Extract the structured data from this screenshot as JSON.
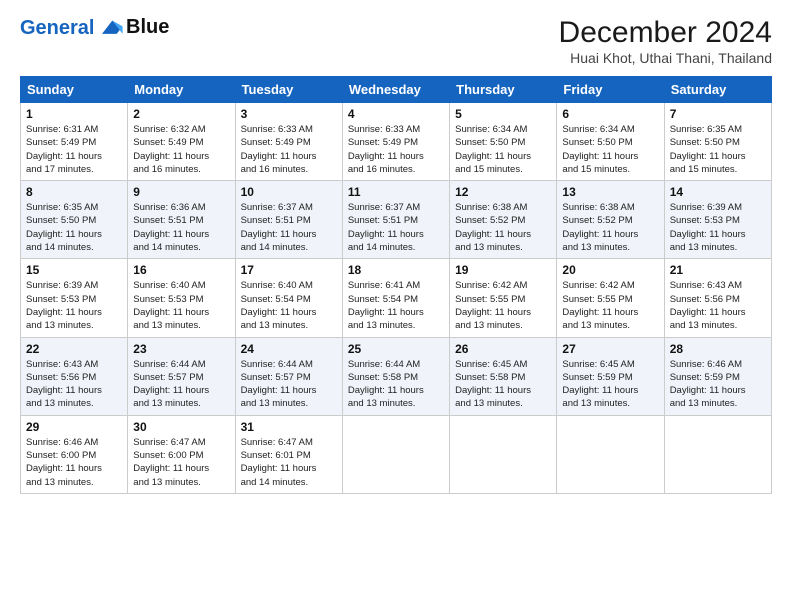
{
  "logo": {
    "line1": "General",
    "line2": "Blue"
  },
  "title": "December 2024",
  "subtitle": "Huai Khot, Uthai Thani, Thailand",
  "weekdays": [
    "Sunday",
    "Monday",
    "Tuesday",
    "Wednesday",
    "Thursday",
    "Friday",
    "Saturday"
  ],
  "weeks": [
    [
      {
        "day": "1",
        "info": "Sunrise: 6:31 AM\nSunset: 5:49 PM\nDaylight: 11 hours\nand 17 minutes."
      },
      {
        "day": "2",
        "info": "Sunrise: 6:32 AM\nSunset: 5:49 PM\nDaylight: 11 hours\nand 16 minutes."
      },
      {
        "day": "3",
        "info": "Sunrise: 6:33 AM\nSunset: 5:49 PM\nDaylight: 11 hours\nand 16 minutes."
      },
      {
        "day": "4",
        "info": "Sunrise: 6:33 AM\nSunset: 5:49 PM\nDaylight: 11 hours\nand 16 minutes."
      },
      {
        "day": "5",
        "info": "Sunrise: 6:34 AM\nSunset: 5:50 PM\nDaylight: 11 hours\nand 15 minutes."
      },
      {
        "day": "6",
        "info": "Sunrise: 6:34 AM\nSunset: 5:50 PM\nDaylight: 11 hours\nand 15 minutes."
      },
      {
        "day": "7",
        "info": "Sunrise: 6:35 AM\nSunset: 5:50 PM\nDaylight: 11 hours\nand 15 minutes."
      }
    ],
    [
      {
        "day": "8",
        "info": "Sunrise: 6:35 AM\nSunset: 5:50 PM\nDaylight: 11 hours\nand 14 minutes."
      },
      {
        "day": "9",
        "info": "Sunrise: 6:36 AM\nSunset: 5:51 PM\nDaylight: 11 hours\nand 14 minutes."
      },
      {
        "day": "10",
        "info": "Sunrise: 6:37 AM\nSunset: 5:51 PM\nDaylight: 11 hours\nand 14 minutes."
      },
      {
        "day": "11",
        "info": "Sunrise: 6:37 AM\nSunset: 5:51 PM\nDaylight: 11 hours\nand 14 minutes."
      },
      {
        "day": "12",
        "info": "Sunrise: 6:38 AM\nSunset: 5:52 PM\nDaylight: 11 hours\nand 13 minutes."
      },
      {
        "day": "13",
        "info": "Sunrise: 6:38 AM\nSunset: 5:52 PM\nDaylight: 11 hours\nand 13 minutes."
      },
      {
        "day": "14",
        "info": "Sunrise: 6:39 AM\nSunset: 5:53 PM\nDaylight: 11 hours\nand 13 minutes."
      }
    ],
    [
      {
        "day": "15",
        "info": "Sunrise: 6:39 AM\nSunset: 5:53 PM\nDaylight: 11 hours\nand 13 minutes."
      },
      {
        "day": "16",
        "info": "Sunrise: 6:40 AM\nSunset: 5:53 PM\nDaylight: 11 hours\nand 13 minutes."
      },
      {
        "day": "17",
        "info": "Sunrise: 6:40 AM\nSunset: 5:54 PM\nDaylight: 11 hours\nand 13 minutes."
      },
      {
        "day": "18",
        "info": "Sunrise: 6:41 AM\nSunset: 5:54 PM\nDaylight: 11 hours\nand 13 minutes."
      },
      {
        "day": "19",
        "info": "Sunrise: 6:42 AM\nSunset: 5:55 PM\nDaylight: 11 hours\nand 13 minutes."
      },
      {
        "day": "20",
        "info": "Sunrise: 6:42 AM\nSunset: 5:55 PM\nDaylight: 11 hours\nand 13 minutes."
      },
      {
        "day": "21",
        "info": "Sunrise: 6:43 AM\nSunset: 5:56 PM\nDaylight: 11 hours\nand 13 minutes."
      }
    ],
    [
      {
        "day": "22",
        "info": "Sunrise: 6:43 AM\nSunset: 5:56 PM\nDaylight: 11 hours\nand 13 minutes."
      },
      {
        "day": "23",
        "info": "Sunrise: 6:44 AM\nSunset: 5:57 PM\nDaylight: 11 hours\nand 13 minutes."
      },
      {
        "day": "24",
        "info": "Sunrise: 6:44 AM\nSunset: 5:57 PM\nDaylight: 11 hours\nand 13 minutes."
      },
      {
        "day": "25",
        "info": "Sunrise: 6:44 AM\nSunset: 5:58 PM\nDaylight: 11 hours\nand 13 minutes."
      },
      {
        "day": "26",
        "info": "Sunrise: 6:45 AM\nSunset: 5:58 PM\nDaylight: 11 hours\nand 13 minutes."
      },
      {
        "day": "27",
        "info": "Sunrise: 6:45 AM\nSunset: 5:59 PM\nDaylight: 11 hours\nand 13 minutes."
      },
      {
        "day": "28",
        "info": "Sunrise: 6:46 AM\nSunset: 5:59 PM\nDaylight: 11 hours\nand 13 minutes."
      }
    ],
    [
      {
        "day": "29",
        "info": "Sunrise: 6:46 AM\nSunset: 6:00 PM\nDaylight: 11 hours\nand 13 minutes."
      },
      {
        "day": "30",
        "info": "Sunrise: 6:47 AM\nSunset: 6:00 PM\nDaylight: 11 hours\nand 13 minutes."
      },
      {
        "day": "31",
        "info": "Sunrise: 6:47 AM\nSunset: 6:01 PM\nDaylight: 11 hours\nand 14 minutes."
      },
      null,
      null,
      null,
      null
    ]
  ]
}
